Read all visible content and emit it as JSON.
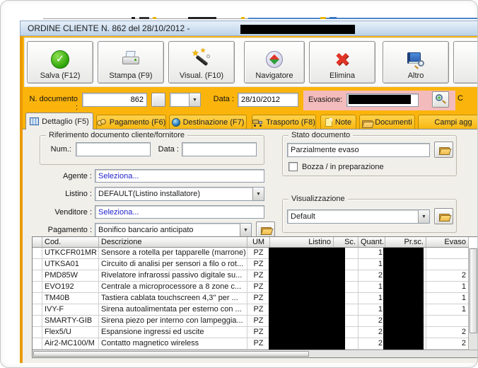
{
  "window": {
    "title": "ORDINE CLIENTE N. 862  del 28/10/2012 -",
    "title_value_redacted": true
  },
  "toolbar": {
    "buttons": [
      {
        "label": "Salva (F12)",
        "icon": "save-check-icon"
      },
      {
        "label": "Stampa (F9)",
        "icon": "printer-icon"
      },
      {
        "label": "Visual. (F10)",
        "icon": "magic-wand-icon"
      },
      {
        "label": "Navigatore",
        "icon": "compass-icon"
      },
      {
        "label": "Elimina",
        "icon": "delete-x-icon"
      },
      {
        "label": "Altro",
        "icon": "book-magnifier-icon"
      }
    ]
  },
  "doc_header": {
    "n_documento_label": "N. documento :",
    "n_documento_value": "862",
    "doc_type_combo_value": "",
    "data_label": "Data :",
    "data_value": "28/10/2012",
    "evasione_label": "Evasione:",
    "evasione_value_redacted": true,
    "clipped_label": "C"
  },
  "tabs": [
    {
      "label": "Dettaglio (F5)",
      "icon": "grid-icon",
      "active": true
    },
    {
      "label": "Pagamento (F6)",
      "icon": "coins-icon",
      "active": false
    },
    {
      "label": "Destinazione (F7)",
      "icon": "globe-icon",
      "active": false
    },
    {
      "label": "Trasporto (F8)",
      "icon": "truck-icon",
      "active": false
    },
    {
      "label": "Note",
      "icon": "note-icon",
      "active": false
    },
    {
      "label": "Documenti",
      "icon": "folder-icon",
      "active": false
    },
    {
      "label": "Campi agg",
      "icon": "",
      "active": false
    }
  ],
  "detail_form": {
    "riferimento_group_label": "Riferimento documento cliente/fornitore",
    "num_label": "Num.:",
    "num_value": "",
    "rif_data_label": "Data :",
    "rif_data_value": "",
    "stato_group_label": "Stato documento",
    "stato_value": "Parzialmente evaso",
    "bozza_checkbox_label": "Bozza / in preparazione",
    "bozza_checked": false,
    "agente_label": "Agente :",
    "agente_value": "Seleziona...",
    "listino_label": "Listino :",
    "listino_value": "DEFAULT(Listino installatore)",
    "venditore_label": "Venditore :",
    "venditore_value": "Seleziona...",
    "pagamento_label": "Pagamento :",
    "pagamento_value": "Bonifico bancario anticipato",
    "visualizzazione_group_label": "Visualizzazione",
    "visualizzazione_value": "Default"
  },
  "table": {
    "columns": [
      "",
      "Cod.",
      "Descrizione",
      "UM",
      "Listino",
      "Sc.",
      "Quant.",
      "Pr.sc.",
      "Evaso"
    ],
    "redacted_columns": [
      "Listino",
      "Sc.",
      "Pr.sc."
    ],
    "rows": [
      {
        "cod": "UTKCFR01MR",
        "descrizione": "Sensore a rotella per tapparelle (marrone)",
        "um": "PZ",
        "quant": "1",
        "evaso": ""
      },
      {
        "cod": "UTKSA01",
        "descrizione": "Circuito di analisi per sensori a filo o rot...",
        "um": "PZ",
        "quant": "1",
        "evaso": ""
      },
      {
        "cod": "PMD85W",
        "descrizione": "Rivelatore infrarossi passivo digitale su...",
        "um": "PZ",
        "quant": "2",
        "evaso": "2"
      },
      {
        "cod": "EVO192",
        "descrizione": "Centrale a microprocessore a 8 zone c...",
        "um": "PZ",
        "quant": "1",
        "evaso": "1"
      },
      {
        "cod": "TM40B",
        "descrizione": "Tastiera cablata touchscreen 4,3'' per ...",
        "um": "PZ",
        "quant": "1",
        "evaso": "1"
      },
      {
        "cod": "IVY-F",
        "descrizione": "Sirena autoalimentata per esterno con ...",
        "um": "PZ",
        "quant": "1",
        "evaso": "1"
      },
      {
        "cod": "SMARTY-GIB",
        "descrizione": "Sirena piezo per interno con lampeggia...",
        "um": "PZ",
        "quant": "2",
        "evaso": ""
      },
      {
        "cod": "Flex5/U",
        "descrizione": "Espansione ingressi ed uscite",
        "um": "PZ",
        "quant": "2",
        "evaso": "2"
      },
      {
        "cod": "Air2-MC100/M",
        "descrizione": "Contatto magnetico wireless",
        "um": "PZ",
        "quant": "2",
        "evaso": "2"
      }
    ]
  },
  "colors": {
    "amber": "#FBB40C",
    "amber_border": "#E89B00",
    "pink": "#F3BBBB",
    "titlebar_blue": "#BCD2E8",
    "link_blue": "#2222CC",
    "content_bg": "#F1EFEA"
  }
}
